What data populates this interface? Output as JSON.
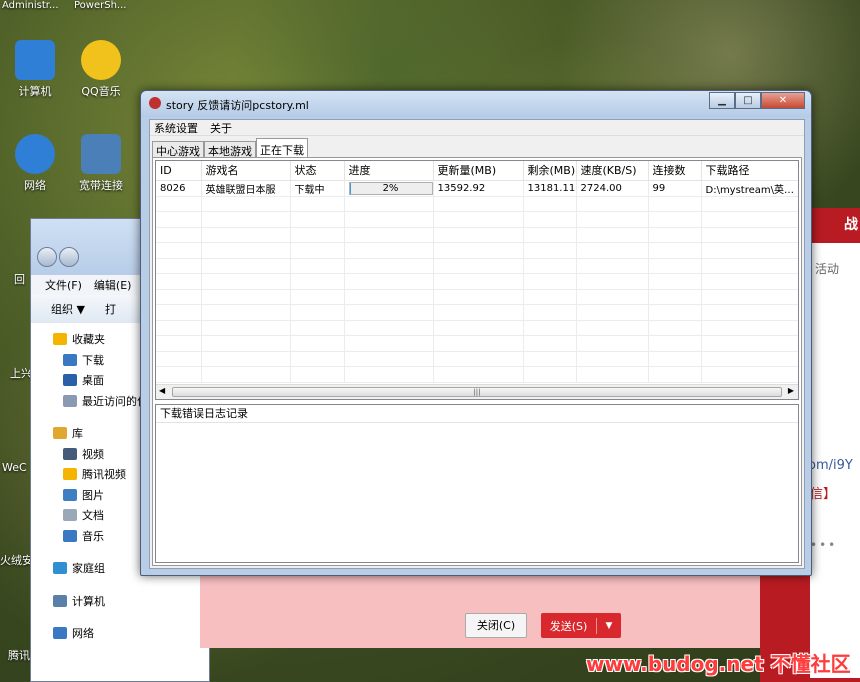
{
  "desktop": {
    "top_labels": [
      "Administr...",
      "PowerSh..."
    ],
    "icons": [
      {
        "label": "计算机",
        "icon": "computer-icon",
        "color": "#2f7fd6"
      },
      {
        "label": "QQ音乐",
        "icon": "qqmusic-icon",
        "color": "#f2c21c"
      },
      {
        "label": "网络",
        "icon": "network-icon",
        "color": "#2f7fd6"
      },
      {
        "label": "宽带连接",
        "icon": "broadband-icon",
        "color": "#4a7fb7"
      }
    ],
    "edge_labels": [
      "回",
      "上兴",
      "WeC",
      "火绒安",
      "腾讯"
    ]
  },
  "explorer": {
    "menu": [
      "文件(F)",
      "编辑(E)"
    ],
    "toolbar": [
      "组织 ▼",
      "打"
    ],
    "sidebar": [
      {
        "label": "收藏夹",
        "color": "#f4b400",
        "gap_before": false
      },
      {
        "label": "下载",
        "color": "#3b78c4",
        "gap_before": false
      },
      {
        "label": "桌面",
        "color": "#2b5fa8",
        "gap_before": false
      },
      {
        "label": "最近访问的位",
        "color": "#8a9ab0",
        "gap_before": false
      },
      {
        "label": "库",
        "color": "#e0a82e",
        "gap_before": true
      },
      {
        "label": "视频",
        "color": "#445c7a",
        "gap_before": false
      },
      {
        "label": "腾讯视频",
        "color": "#f4b400",
        "gap_before": false
      },
      {
        "label": "图片",
        "color": "#3d7fc1",
        "gap_before": false
      },
      {
        "label": "文档",
        "color": "#9aa8b8",
        "gap_before": false
      },
      {
        "label": "音乐",
        "color": "#3b78c4",
        "gap_before": false
      },
      {
        "label": "家庭组",
        "color": "#2f8fd0",
        "gap_before": true
      },
      {
        "label": "计算机",
        "color": "#5a7fa8",
        "gap_before": true
      },
      {
        "label": "网络",
        "color": "#3b78c4",
        "gap_before": true
      }
    ]
  },
  "background_page": {
    "text1": "战",
    "text2": "活动",
    "text3": "om/i9Y",
    "text4": "信】",
    "text5": "•••",
    "close_button": "关闭(C)",
    "send_button": "发送(S)",
    "watermark": "www.budog.net 不懂社区"
  },
  "window": {
    "title": "story 反馈请访问pcstory.ml",
    "menu": [
      "系统设置",
      "关于"
    ],
    "tabs": [
      "中心游戏",
      "本地游戏",
      "正在下载"
    ],
    "active_tab": 2,
    "columns": [
      {
        "label": "ID",
        "width": 45
      },
      {
        "label": "游戏名",
        "width": 89
      },
      {
        "label": "状态",
        "width": 54
      },
      {
        "label": "进度",
        "width": 89
      },
      {
        "label": "更新量(MB)",
        "width": 90
      },
      {
        "label": "剩余(MB)",
        "width": 53
      },
      {
        "label": "速度(KB/S)",
        "width": 72
      },
      {
        "label": "连接数",
        "width": 53
      },
      {
        "label": "下载路径",
        "width": 100
      }
    ],
    "rows": [
      {
        "id": "8026",
        "name": "英雄联盟日本服",
        "status": "下载中",
        "progress_value": 0.02,
        "progress": "2%",
        "update": "13592.92",
        "remaining": "13181.11",
        "speed": "2724.00",
        "connections": "99",
        "path": "D:\\mystream\\英雄..."
      }
    ],
    "empty_rows": 12,
    "log_header": "下载错误日志记录",
    "colors": {
      "progress": "#3d9ad9",
      "close_button": "#c74a33"
    }
  }
}
